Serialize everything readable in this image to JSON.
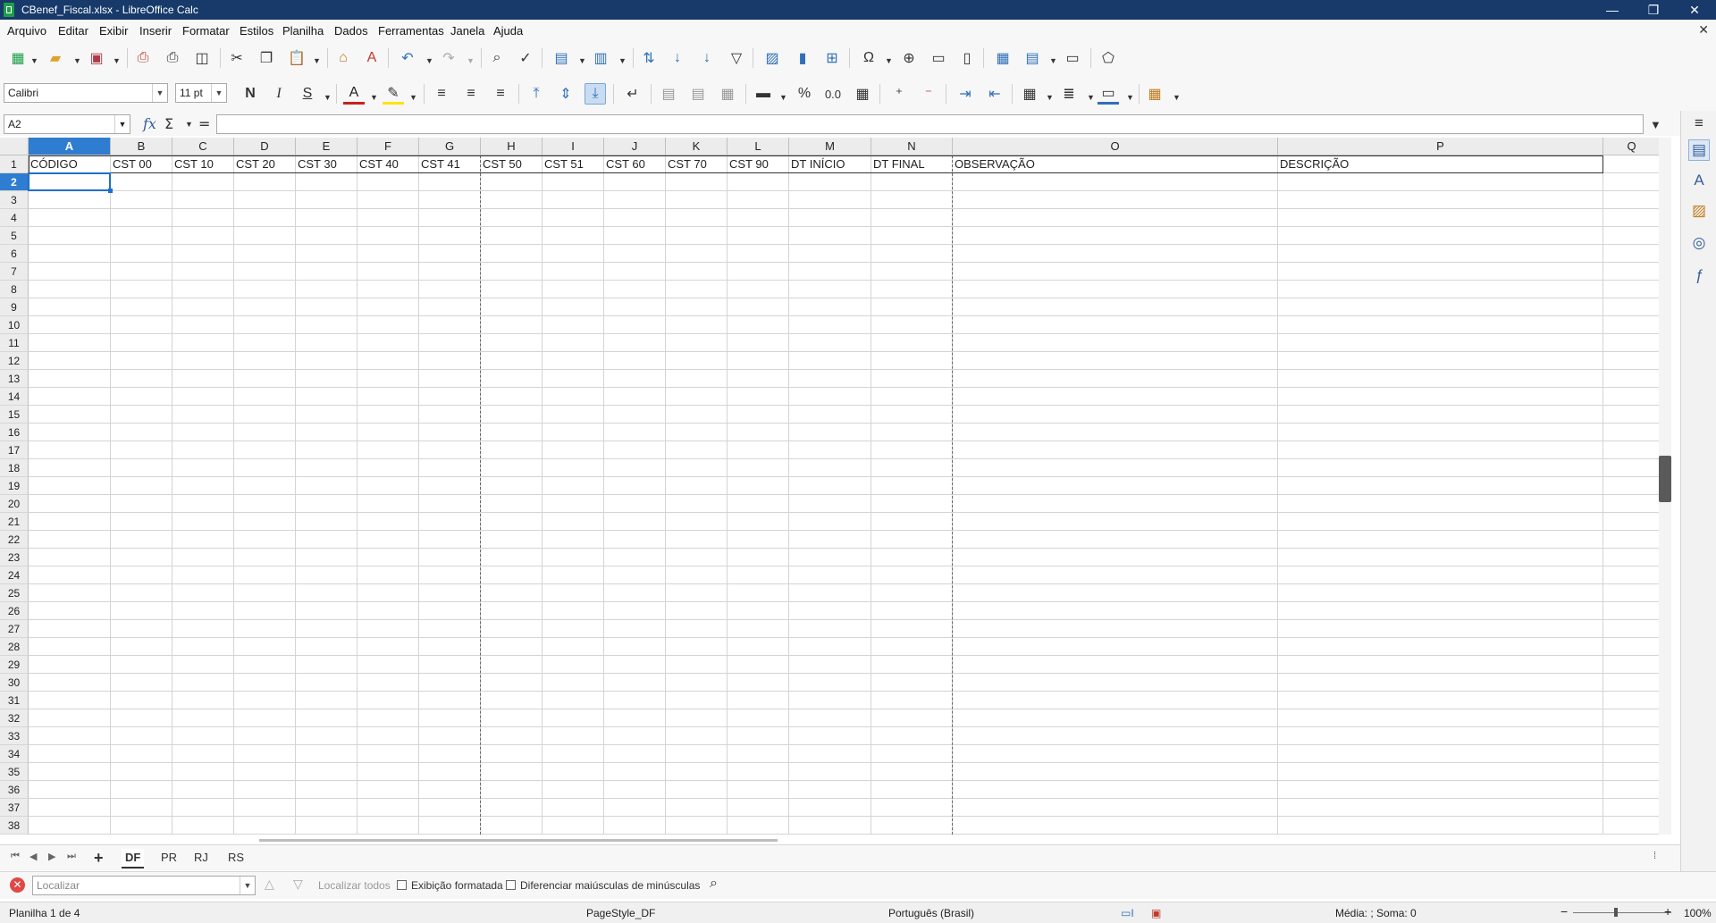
{
  "window": {
    "title": "CBenef_Fiscal.xlsx - LibreOffice Calc",
    "minimize": "—",
    "maximize": "❐",
    "close": "✕",
    "doc_close": "✕"
  },
  "menu": [
    "Arquivo",
    "Editar",
    "Exibir",
    "Inserir",
    "Formatar",
    "Estilos",
    "Planilha",
    "Dados",
    "Ferramentas",
    "Janela",
    "Ajuda"
  ],
  "formatting": {
    "font_name": "Calibri",
    "font_size": "11 pt",
    "bold_label": "N",
    "italic_label": "I",
    "strike_label": "S",
    "percent_label": "%",
    "number_label": "0.0"
  },
  "formula_bar": {
    "cell_ref": "A2",
    "fx": "fx",
    "sum": "Σ",
    "equals": "=",
    "content": ""
  },
  "columns": [
    "A",
    "B",
    "C",
    "D",
    "E",
    "F",
    "G",
    "H",
    "I",
    "J",
    "K",
    "L",
    "M",
    "N",
    "O",
    "P",
    "Q"
  ],
  "header_row": [
    "CÓDIGO",
    "CST 00",
    "CST 10",
    "CST 20",
    "CST 30",
    "CST 40",
    "CST 41",
    "CST 50",
    "CST 51",
    "CST 60",
    "CST 70",
    "CST 90",
    "DT INÍCIO",
    "DT FINAL",
    "OBSERVAÇÃO",
    "DESCRIÇÃO"
  ],
  "rows": [
    "1",
    "2",
    "3",
    "4",
    "5",
    "6",
    "7",
    "8",
    "9",
    "10",
    "11",
    "12",
    "13",
    "14",
    "15",
    "16",
    "17",
    "18",
    "19",
    "20",
    "21",
    "22",
    "23",
    "24",
    "25",
    "26",
    "27",
    "28",
    "29",
    "30",
    "31",
    "32",
    "33",
    "34",
    "35",
    "36",
    "37",
    "38"
  ],
  "selected_cell": "A2",
  "sheets": {
    "add": "+",
    "tabs": [
      "DF",
      "PR",
      "RJ",
      "RS"
    ],
    "active": "DF"
  },
  "find": {
    "placeholder": "Localizar",
    "find_all": "Localizar todos",
    "formatted": "Exibição formatada",
    "match_case": "Diferenciar maiúsculas de minúsculas"
  },
  "status": {
    "sheet": "Planilha 1 de 4",
    "page_style": "PageStyle_DF",
    "language": "Português (Brasil)",
    "summary": "Média: ; Soma: 0",
    "zoom": "100%"
  },
  "colors": {
    "title_bar": "#173a6b",
    "selection": "#2f7dd1",
    "accent": "#1f6fc9"
  }
}
